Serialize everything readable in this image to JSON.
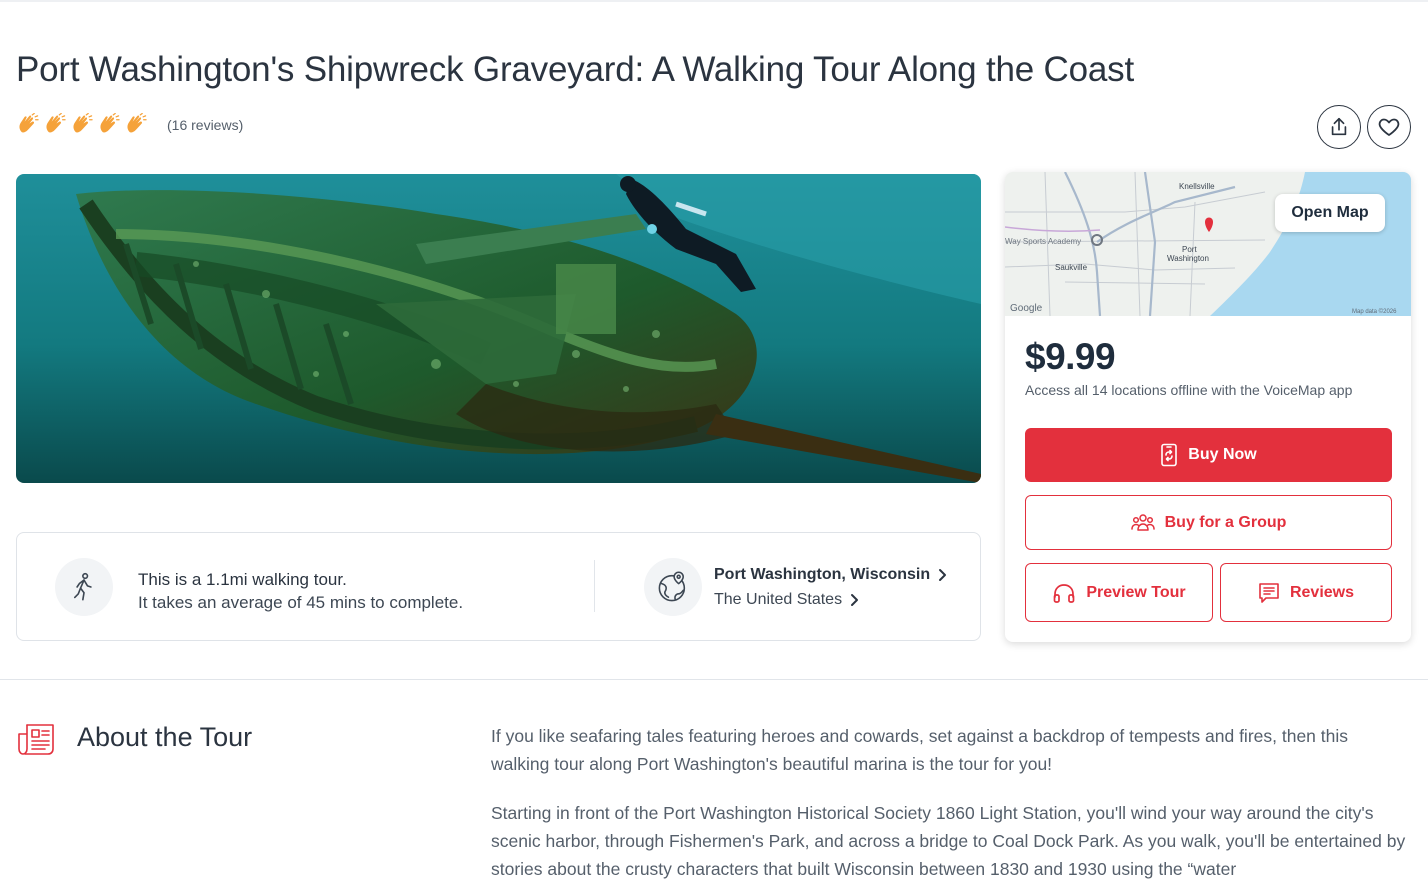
{
  "page": {
    "title": "Port Washington's Shipwreck Graveyard: A Walking Tour Along the Coast"
  },
  "rating": {
    "icons": [
      "clap-icon",
      "clap-icon",
      "clap-icon",
      "clap-icon",
      "clap-icon"
    ],
    "reviews_text": "(16 reviews)"
  },
  "actions": {
    "share_icon": "share-icon",
    "favorite_icon": "heart-icon"
  },
  "hero": {
    "icon": "shipwreck-photo"
  },
  "tour_info": {
    "walk_line1": "This is a 1.1mi walking tour.",
    "walk_line2": "It takes an average of 45 mins to complete.",
    "location_city": "Port Washington, Wisconsin",
    "location_country": "The United States"
  },
  "map": {
    "open_label": "Open Map",
    "labels": {
      "town1": "Knellsville",
      "town2": "Port",
      "town2b": "Washington",
      "town3": "Saukville",
      "poi": "Way Sports Academy",
      "brand": "Google",
      "attribution": "Map data ©2026"
    }
  },
  "purchase": {
    "price": "$9.99",
    "access_text": "Access all 14 locations offline with the VoiceMap app",
    "buy_now": "Buy Now",
    "buy_group": "Buy for a Group",
    "preview": "Preview Tour",
    "reviews": "Reviews"
  },
  "about": {
    "title": "About the Tour",
    "paragraph1": "If you like seafaring tales featuring heroes and cowards, set against a backdrop of tempests and fires, then this walking tour along Port Washington's beautiful marina is the tour for you!",
    "paragraph2": "Starting in front of the Port Washington Historical Society 1860 Light Station, you'll wind your way around the city's scenic harbor, through Fishermen's Park, and across a bridge to Coal Dock Park. As you walk, you'll be entertained by stories about the crusty characters that built Wisconsin between 1830 and 1930 using the “water"
  },
  "colors": {
    "brand_red": "#e3303d",
    "text_dark": "#2b3440",
    "text_muted": "#555f6b",
    "clap_orange": "#f5a23a"
  }
}
